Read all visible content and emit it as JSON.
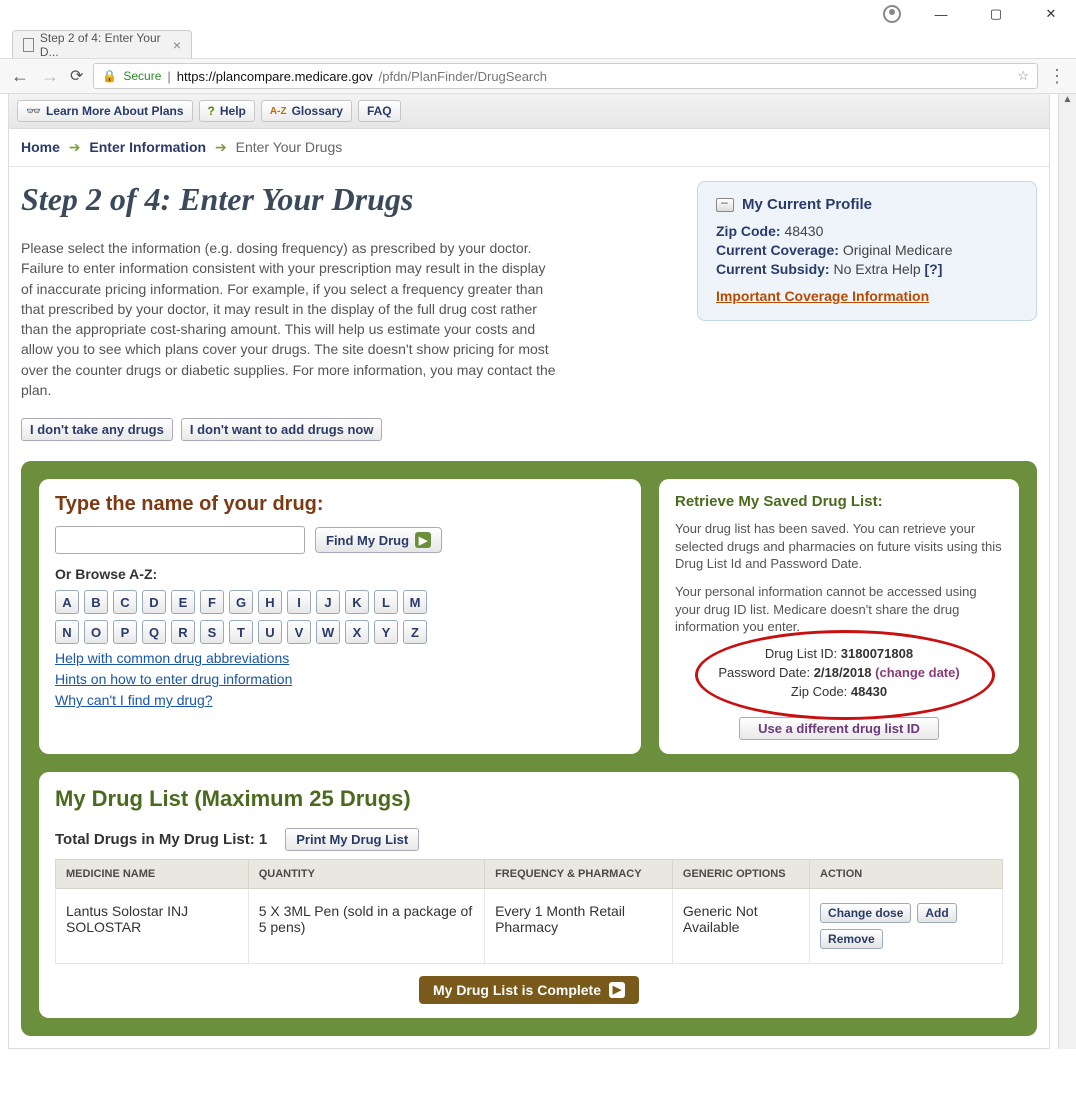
{
  "window": {
    "tab_title": "Step 2 of 4: Enter Your D..."
  },
  "urlbar": {
    "secure": "Secure",
    "host": "https://plancompare.medicare.gov",
    "path": "/pfdn/PlanFinder/DrugSearch"
  },
  "toplinks": {
    "learn": "Learn More About Plans",
    "help": "Help",
    "glossary": "Glossary",
    "faq": "FAQ"
  },
  "breadcrumb": {
    "home": "Home",
    "enter_info": "Enter Information",
    "current": "Enter Your Drugs"
  },
  "title": "Step 2 of 4: Enter Your Drugs",
  "intro": "Please select the information (e.g. dosing frequency) as prescribed by your doctor. Failure to enter information consistent with your prescription may result in the display of inaccurate pricing information. For example, if you select a frequency greater than that prescribed by your doctor, it may result in the display of the full drug cost rather than the appropriate cost-sharing amount. This will help us estimate your costs and allow you to see which plans cover your drugs. The site doesn't show pricing for most over the counter drugs or diabetic supplies. For more information, you may contact the plan.",
  "skip_buttons": {
    "no_drugs": "I don't take any drugs",
    "no_add": "I don't want to add drugs now"
  },
  "profile": {
    "title": "My Current Profile",
    "zip_label": "Zip Code:",
    "zip": "48430",
    "coverage_label": "Current Coverage:",
    "coverage": "Original Medicare",
    "subsidy_label": "Current Subsidy:",
    "subsidy": "No Extra Help",
    "q": "[?]",
    "important": "Important Coverage Information"
  },
  "search": {
    "heading": "Type the name of your drug:",
    "find_btn": "Find My Drug",
    "browse_label": "Or Browse A-Z:",
    "row1": [
      "A",
      "B",
      "C",
      "D",
      "E",
      "F",
      "G",
      "H",
      "I",
      "J",
      "K",
      "L",
      "M"
    ],
    "row2": [
      "N",
      "O",
      "P",
      "Q",
      "R",
      "S",
      "T",
      "U",
      "V",
      "W",
      "X",
      "Y",
      "Z"
    ],
    "help1": "Help with common drug abbreviations",
    "help2": "Hints on how to enter drug information",
    "help3": "Why can't I find my drug?"
  },
  "retrieve": {
    "title": "Retrieve My Saved Drug List:",
    "p1": "Your drug list has been saved. You can retrieve your selected drugs and pharmacies on future visits using this Drug List Id and Password Date.",
    "p2": "Your personal information cannot be accessed using your drug ID list. Medicare doesn't share the drug information you enter.",
    "drug_list_id_label": "Drug List ID:",
    "drug_list_id": "3180071808",
    "pw_date_label": "Password Date:",
    "pw_date": "2/18/2018",
    "change": "(change date)",
    "zip_label": "Zip Code:",
    "zip": "48430",
    "diff_btn": "Use a different drug list ID"
  },
  "druglist": {
    "title": "My Drug List (Maximum 25 Drugs)",
    "count_label": "Total Drugs in My Drug List:",
    "count": "1",
    "print": "Print My Drug List",
    "headers": {
      "name": "MEDICINE NAME",
      "qty": "QUANTITY",
      "freq": "FREQUENCY & PHARMACY",
      "generic": "GENERIC OPTIONS",
      "action": "ACTION"
    },
    "rows": [
      {
        "name": "Lantus Solostar INJ SOLOSTAR",
        "qty": "5 X 3ML Pen (sold in a package of 5 pens)",
        "freq": "Every 1 Month Retail Pharmacy",
        "generic": "Generic Not Available"
      }
    ],
    "actions": {
      "change": "Change dose",
      "add": "Add",
      "remove": "Remove"
    },
    "complete": "My Drug List is Complete"
  }
}
